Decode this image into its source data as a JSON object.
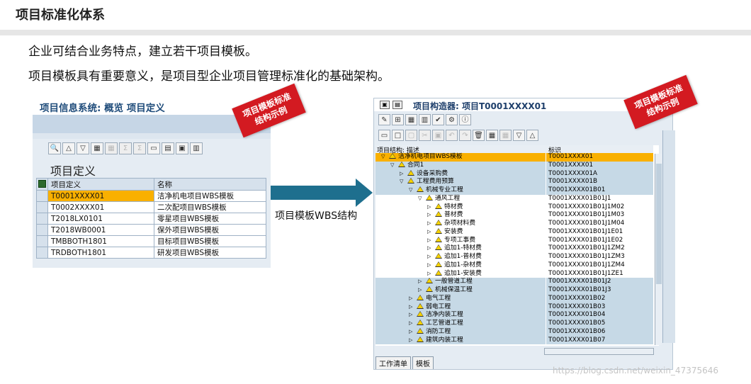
{
  "slide": {
    "title": "项目标准化体系",
    "line1": "企业可结合业务特点，建立若干项目模板。",
    "line2": "项目模板具有重要意义，是项目型企业项目管理标准化的基础架构。",
    "arrow_label": "项目模板WBS结构",
    "watermark": "https://blog.csdn.net/weixin_47375646"
  },
  "left_window": {
    "title": "项目信息系统: 概览 项目定义",
    "section": "项目定义",
    "badge_line1": "项目模板标准",
    "badge_line2": "结构示例",
    "columns": [
      "项目定义",
      "名称"
    ],
    "rows": [
      {
        "id": "T0001XXXX01",
        "name": "洁净机电项目WBS模板",
        "selected": true
      },
      {
        "id": "T0002XXXX01",
        "name": "二次配项目WBS模板",
        "selected": false
      },
      {
        "id": "T2018LX0101",
        "name": "零星项目WBS模板",
        "selected": false
      },
      {
        "id": "T2018WB0001",
        "name": "保外项目WBS模板",
        "selected": false
      },
      {
        "id": "TMBBOTH1801",
        "name": "目标项目WBS模板",
        "selected": false
      },
      {
        "id": "TRDBOTH1801",
        "name": "研发项目WBS模板",
        "selected": false
      }
    ]
  },
  "right_window": {
    "title": "项目构造器: 项目T0001XXXX01",
    "badge_line1": "项目模板标准",
    "badge_line2": "结构示例",
    "col_desc": "项目结构: 描述",
    "col_id": "标识",
    "tab_worklist": "工作清单",
    "tab_template": "模板",
    "rows": [
      {
        "level": 0,
        "label": "洁净机电项目WBS模板",
        "id": "T0001XXXX01",
        "style": "hl"
      },
      {
        "level": 1,
        "label": "合同1",
        "id": "T0001XXXX01",
        "style": "blue"
      },
      {
        "level": 2,
        "label": "设备采购费",
        "id": "T0001XXXX01A",
        "style": "blue"
      },
      {
        "level": 2,
        "label": "工程费用预算",
        "id": "T0001XXXX01B",
        "style": "blue"
      },
      {
        "level": 3,
        "label": "机械专业工程",
        "id": "T0001XXXX01B01",
        "style": "blue"
      },
      {
        "level": 4,
        "label": "通风工程",
        "id": "T0001XXXX01B01J1",
        "style": "wht"
      },
      {
        "level": 5,
        "label": "特材费",
        "id": "T0001XXXX01B01J1M02",
        "style": "wht"
      },
      {
        "level": 5,
        "label": "普材费",
        "id": "T0001XXXX01B01J1M03",
        "style": "wht"
      },
      {
        "level": 5,
        "label": "杂项材料费",
        "id": "T0001XXXX01B01J1M04",
        "style": "wht"
      },
      {
        "level": 5,
        "label": "安装费",
        "id": "T0001XXXX01B01J1E01",
        "style": "wht"
      },
      {
        "level": 5,
        "label": "专项工事费",
        "id": "T0001XXXX01B01J1E02",
        "style": "wht"
      },
      {
        "level": 5,
        "label": "追加1-特材费",
        "id": "T0001XXXX01B01J1ZM2",
        "style": "wht"
      },
      {
        "level": 5,
        "label": "追加1-普材费",
        "id": "T0001XXXX01B01J1ZM3",
        "style": "wht"
      },
      {
        "level": 5,
        "label": "追加1-杂材费",
        "id": "T0001XXXX01B01J1ZM4",
        "style": "wht"
      },
      {
        "level": 5,
        "label": "追加1-安装费",
        "id": "T0001XXXX01B01J1ZE1",
        "style": "wht"
      },
      {
        "level": 4,
        "label": "一般管道工程",
        "id": "T0001XXXX01B01J2",
        "style": "blue"
      },
      {
        "level": 4,
        "label": "机械保温工程",
        "id": "T0001XXXX01B01J3",
        "style": "blue"
      },
      {
        "level": 3,
        "label": "电气工程",
        "id": "T0001XXXX01B02",
        "style": "blue"
      },
      {
        "level": 3,
        "label": "弱电工程",
        "id": "T0001XXXX01B03",
        "style": "blue"
      },
      {
        "level": 3,
        "label": "洁净内装工程",
        "id": "T0001XXXX01B04",
        "style": "blue"
      },
      {
        "level": 3,
        "label": "工艺管道工程",
        "id": "T0001XXXX01B05",
        "style": "blue"
      },
      {
        "level": 3,
        "label": "消防工程",
        "id": "T0001XXXX01B06",
        "style": "blue"
      },
      {
        "level": 3,
        "label": "建筑内装工程",
        "id": "T0001XXXX01B07",
        "style": "blue"
      }
    ]
  }
}
